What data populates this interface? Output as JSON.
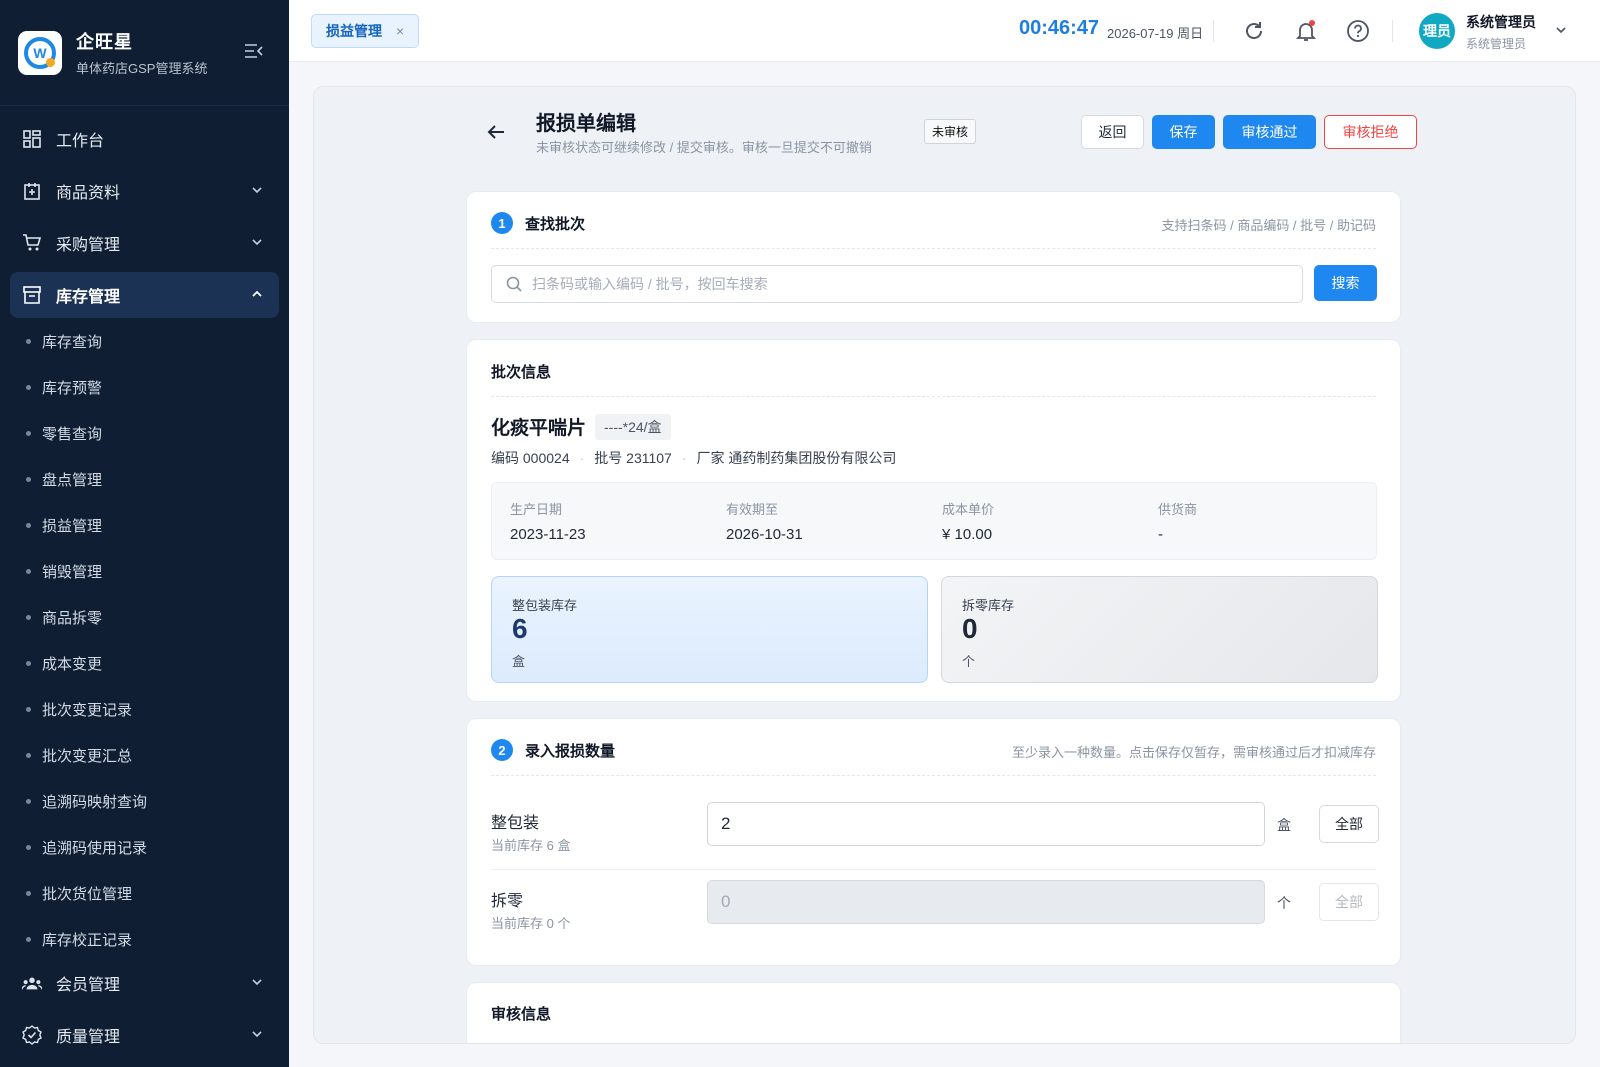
{
  "brand": {
    "name": "企旺星",
    "subtitle": "单体药店GSP管理系统",
    "logo_letter": "W"
  },
  "sidebar": {
    "items": [
      {
        "label": "工作台",
        "icon": "dashboard-icon"
      },
      {
        "label": "商品资料",
        "icon": "product-icon"
      },
      {
        "label": "采购管理",
        "icon": "cart-icon"
      },
      {
        "label": "库存管理",
        "icon": "inventory-icon",
        "active": true
      },
      {
        "label": "会员管理",
        "icon": "members-icon"
      },
      {
        "label": "质量管理",
        "icon": "quality-icon"
      }
    ],
    "sub_items": [
      "库存查询",
      "库存预警",
      "零售查询",
      "盘点管理",
      "损益管理",
      "销毁管理",
      "商品拆零",
      "成本变更",
      "批次变更记录",
      "批次变更汇总",
      "追溯码映射查询",
      "追溯码使用记录",
      "批次货位管理",
      "库存校正记录"
    ]
  },
  "header": {
    "tab_label": "损益管理",
    "tab_close": "×",
    "clock": "00:46:47",
    "date": "2026-07-19 周日",
    "avatar_text": "理员",
    "user_name": "系统管理员",
    "user_role": "系统管理员"
  },
  "page": {
    "title": "报损单编辑",
    "subtitle": "未审核状态可继续修改 / 提交审核。审核一旦提交不可撤销",
    "status": "未审核",
    "buttons": {
      "back": "返回",
      "save": "保存",
      "approve": "审核通过",
      "reject": "审核拒绝"
    }
  },
  "search_card": {
    "step": "1",
    "title": "查找批次",
    "hint": "支持扫条码 / 商品编码 / 批号 / 助记码",
    "placeholder": "扫条码或输入编码 / 批号，按回车搜索",
    "button": "搜索"
  },
  "batch_card": {
    "title": "批次信息",
    "product_name": "化痰平喘片",
    "spec": "----*24/盒",
    "code": "编码 000024",
    "batch": "批号 231107",
    "maker": "厂家 通药制药集团股份有限公司",
    "info": [
      {
        "label": "生产日期",
        "value": "2023-11-23"
      },
      {
        "label": "有效期至",
        "value": "2026-10-31"
      },
      {
        "label": "成本单价",
        "value": "¥ 10.00"
      },
      {
        "label": "供货商",
        "value": "-"
      }
    ],
    "whole_stock": {
      "label": "整包装库存",
      "value": "6",
      "unit": "盒"
    },
    "split_stock": {
      "label": "拆零库存",
      "value": "0",
      "unit": "个"
    }
  },
  "qty_card": {
    "step": "2",
    "title": "录入报损数量",
    "hint": "至少录入一种数量。点击保存仅暂存，需审核通过后才扣减库存",
    "rows": [
      {
        "label": "整包装",
        "sub": "当前库存 6 盒",
        "value": "2",
        "unit": "盒",
        "all": "全部",
        "enabled": true
      },
      {
        "label": "拆零",
        "sub": "当前库存 0 个",
        "value": "0",
        "unit": "个",
        "all": "全部",
        "enabled": false
      }
    ]
  },
  "audit_card": {
    "title": "审核信息"
  },
  "colors": {
    "primary": "#1e88f0",
    "sidebar": "#0f1e33",
    "danger": "#ef4444"
  }
}
